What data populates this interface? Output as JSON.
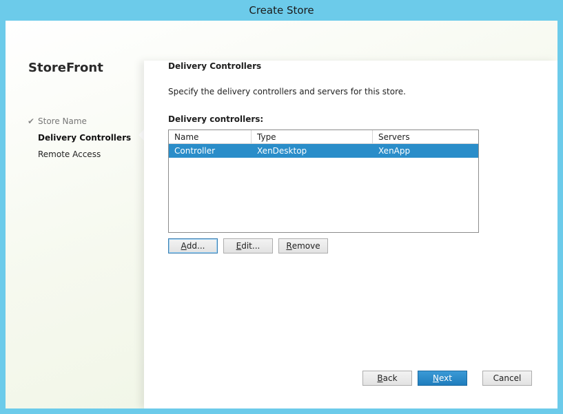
{
  "window": {
    "title": "Create Store"
  },
  "brand": "StoreFront",
  "nav": [
    {
      "label": "Store Name",
      "state": "done",
      "icon": "check-icon"
    },
    {
      "label": "Delivery Controllers",
      "state": "current"
    },
    {
      "label": "Remote Access",
      "state": "pending"
    }
  ],
  "page": {
    "title": "Delivery Controllers",
    "description": "Specify the delivery controllers and servers for this store.",
    "list_label": "Delivery controllers:"
  },
  "table": {
    "columns": [
      "Name",
      "Type",
      "Servers"
    ],
    "rows": [
      {
        "name": "Controller",
        "type": "XenDesktop",
        "servers": "XenApp",
        "selected": true
      }
    ]
  },
  "buttons": {
    "add": {
      "mnemonic": "A",
      "rest": "dd..."
    },
    "edit": {
      "mnemonic": "E",
      "rest": "dit..."
    },
    "remove": {
      "mnemonic": "R",
      "rest": "emove"
    },
    "back": {
      "mnemonic": "B",
      "rest": "ack"
    },
    "next": {
      "mnemonic": "N",
      "rest": "ext"
    },
    "cancel": {
      "label": "Cancel"
    }
  },
  "colors": {
    "frame": "#6ccbea",
    "selection": "#2a8dc9",
    "primary_button": "#1f7dbd"
  }
}
